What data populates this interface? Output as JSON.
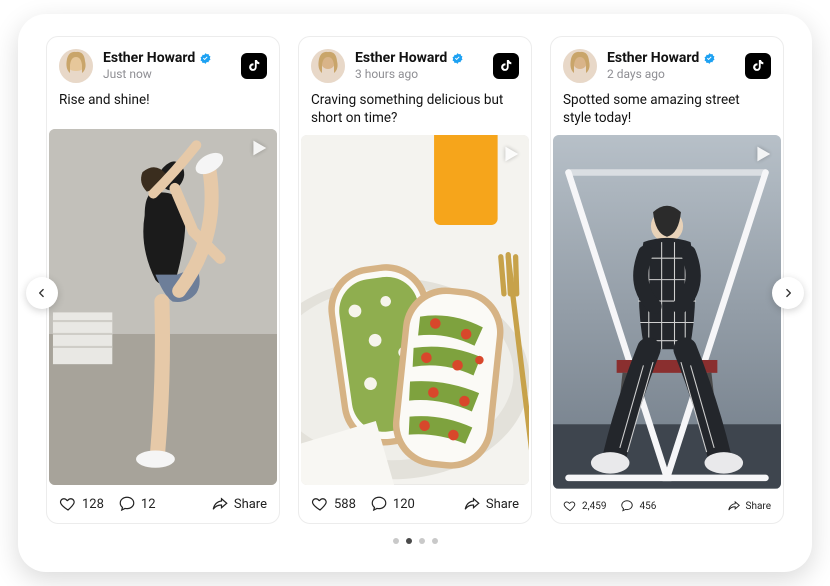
{
  "author": {
    "name": "Esther Howard",
    "verified": true
  },
  "share_label": "Share",
  "posts": [
    {
      "time": "Just now",
      "caption": "Rise and shine!",
      "likes": "128",
      "comments": "12",
      "platform": "tiktok"
    },
    {
      "time": "3 hours ago",
      "caption": "Craving something delicious but short on time?",
      "likes": "588",
      "comments": "120",
      "platform": "tiktok"
    },
    {
      "time": "2 days ago",
      "caption": "Spotted some amazing street style today!",
      "likes": "2,459",
      "comments": "456",
      "platform": "tiktok"
    }
  ],
  "carousel": {
    "total_dots": 4,
    "active_index": 1
  }
}
